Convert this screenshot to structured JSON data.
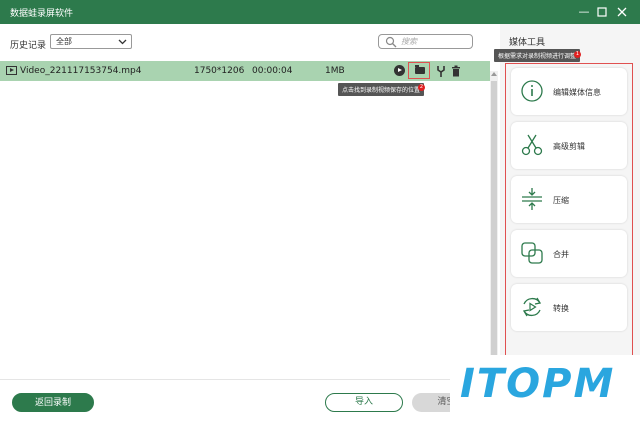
{
  "window": {
    "title": "数据蛙录屏软件"
  },
  "history": {
    "label": "历史记录",
    "filter_value": "全部",
    "search_placeholder": "搜索"
  },
  "files": [
    {
      "name": "Video_221117153754.mp4",
      "resolution": "1750*1206",
      "duration": "00:00:04",
      "size": "1MB"
    }
  ],
  "tooltips": {
    "folder": "点击找到录制视频保存的位置",
    "media": "根据需求对录制视频进行调整",
    "folder_badge": "2",
    "media_badge": "1"
  },
  "buttons": {
    "back": "返回录制",
    "import": "导入",
    "clear": "清空列"
  },
  "media_tools": {
    "title": "媒体工具",
    "items": [
      {
        "label": "编辑媒体信息",
        "icon": "info-icon"
      },
      {
        "label": "高级剪辑",
        "icon": "scissors-icon"
      },
      {
        "label": "压缩",
        "icon": "compress-icon"
      },
      {
        "label": "合并",
        "icon": "merge-icon"
      },
      {
        "label": "转换",
        "icon": "convert-icon"
      }
    ]
  },
  "watermark": {
    "text": "ITOPM"
  },
  "colors": {
    "brand": "#2d7a4c",
    "row_selected": "#a9d3b0",
    "highlight": "#e05050"
  }
}
